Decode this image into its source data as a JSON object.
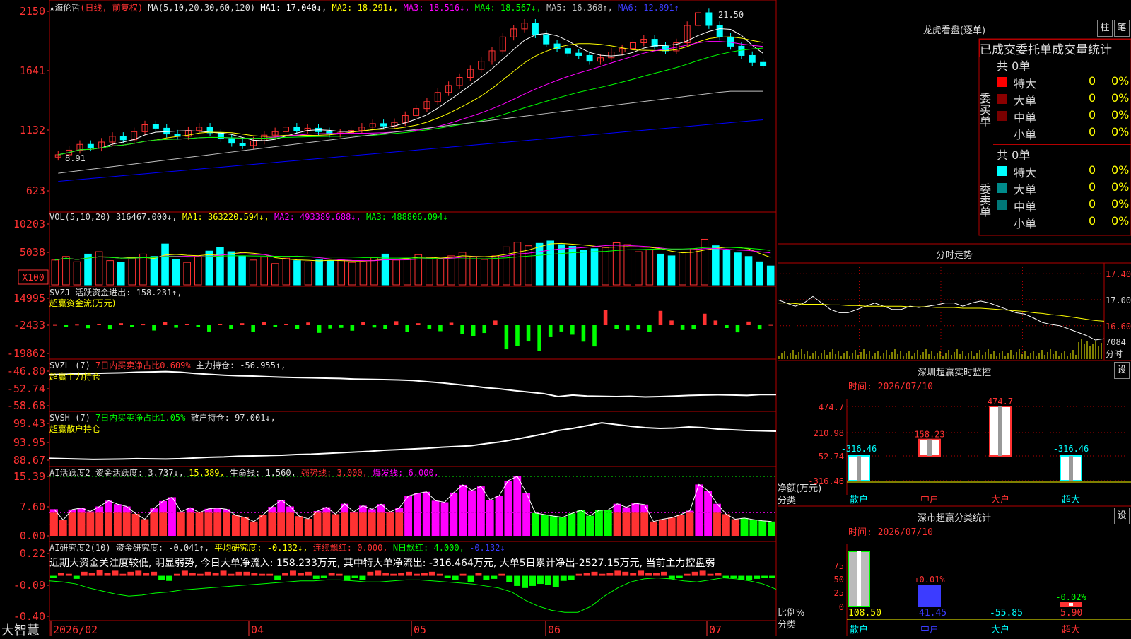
{
  "app": {
    "logo": "大智慧",
    "stock": "★海伦哲"
  },
  "colors": {
    "up": "#ff3232",
    "down": "#00ffff",
    "ma1": "#ffffff",
    "ma2": "#ffff00",
    "ma3": "#ff00ff",
    "ma4": "#00ff00",
    "ma5": "#c0c0c0",
    "ma6": "#0000ff",
    "grid": "#b40000"
  },
  "kline": {
    "period": "(日线, 前复权)",
    "ma_label": "MA(5,10,20,30,60,120)",
    "ma1": "MA1: 17.040↓,",
    "ma2": "MA2: 18.291↓,",
    "ma3": "MA3: 18.516↓,",
    "ma4": "MA4: 18.567↓,",
    "ma5": "MA5: 16.368↑,",
    "ma6": "MA6: 12.891↑",
    "high_mark": "21.50",
    "low_mark": "8.91",
    "y_ticks": [
      "2150",
      "1641",
      "1132",
      "623"
    ]
  },
  "vol": {
    "label": "VOL(5,10,20)",
    "value": "316467.000↓,",
    "ma1": "MA1: 363220.594↓,",
    "ma2": "MA2: 493389.688↓,",
    "ma3": "MA3: 488806.094↓",
    "y_ticks": [
      "10203",
      "5038"
    ],
    "unit": "X100"
  },
  "svzj": {
    "label": "SVZJ",
    "text": "活跃资金进出: 158.231↑,",
    "sub": "超赢资金流(万元)",
    "y_ticks": [
      "14995",
      "-2433",
      "-19862"
    ]
  },
  "svzl": {
    "label": "SVZL (7)",
    "text1": "7日内买卖净占比0.609%",
    "text2": "主力持仓: -56.955↑,",
    "sub": "超赢主力持仓",
    "y_ticks": [
      "-46.80",
      "-52.74",
      "-58.68"
    ]
  },
  "svsh": {
    "label": "SVSH (7)",
    "text1": "7日内买卖净占比1.05%",
    "text2": "散户持仓: 97.001↓,",
    "sub": "超赢散户持仓",
    "y_ticks": [
      "99.43",
      "93.95",
      "88.67"
    ]
  },
  "ai1": {
    "label": "AI活跃度2",
    "t1": "资金活跃度: 3.737↓,",
    "t2": "15.389,",
    "t3": "生命线: 1.560,",
    "t4": "强势线: 3.000,",
    "t5": "爆发线: 6.000,",
    "y_ticks": [
      "15.39",
      "7.60",
      "0.00"
    ]
  },
  "ai2": {
    "label": "AI研究度2(10)",
    "t1": "资金研究度: -0.041↑,",
    "t2": "平均研究度: -0.132↓,",
    "t3": "连续飘红: 0.000,",
    "t4": "N日飘红: 4.000,",
    "t5": "-0.132↓",
    "comment": "近期大资金关注度较低, 明显弱势, 今日大单净流入: 158.233万元, 其中特大单净流出: -316.464万元, 大单5日累计净出-2527.15万元, 当前主力控盘弱",
    "y_ticks": [
      "0.22",
      "-0.09",
      "-0.40"
    ]
  },
  "date_axis": [
    "2026/02",
    "04",
    "05",
    "06",
    "07"
  ],
  "right": {
    "lhb_title": "龙虎看盘(逐单)",
    "btn_zhu": "柱",
    "btn_bi": "笔",
    "header": "已成交委托单成交量统计",
    "buy_side": "委买单",
    "sell_side": "委卖单",
    "buy_total": "共 0单",
    "sell_total": "共 0单",
    "buy_rows": [
      {
        "label": "特大",
        "v": "0",
        "p": "0%",
        "color": "#ff0000"
      },
      {
        "label": "大单",
        "v": "0",
        "p": "0%",
        "color": "#8b0000"
      },
      {
        "label": "中单",
        "v": "0",
        "p": "0%",
        "color": "#7a0000"
      },
      {
        "label": "小单",
        "v": "0",
        "p": "0%",
        "color": "#000000"
      }
    ],
    "sell_rows": [
      {
        "label": "特大",
        "v": "0",
        "p": "0%",
        "color": "#00ffff"
      },
      {
        "label": "大单",
        "v": "0",
        "p": "0%",
        "color": "#008b8b"
      },
      {
        "label": "中单",
        "v": "0",
        "p": "0%",
        "color": "#007878"
      },
      {
        "label": "小单",
        "v": "0",
        "p": "0%",
        "color": "#000000"
      }
    ],
    "fenshi_title": "分时走势",
    "fenshi_ticks": [
      "17.40",
      "17.00",
      "16.60",
      "7084",
      "分时"
    ],
    "sz_title": "深圳超赢实时监控",
    "sz_btn": "设",
    "sz_date": "时间: 2026/07/10",
    "sz_ticks": [
      "474.7",
      "210.98",
      "-52.74",
      "-316.46"
    ],
    "sz_ylabel1": "净额(万元)",
    "sz_ylabel2": "分类",
    "sz_cats": [
      "散户",
      "中户",
      "大户",
      "超大"
    ],
    "sz_labels": [
      "-316.46",
      "158.23",
      "474.7",
      "-316.46"
    ],
    "fl_title": "深市超赢分类统计",
    "fl_btn": "设",
    "fl_date": "时间: 2026/07/10",
    "fl_ticks": [
      "75",
      "50",
      "25",
      "0"
    ],
    "fl_ylabel1": "比例%",
    "fl_ylabel2": "分类",
    "fl_bar_labels": [
      "",
      "+0.01%",
      "",
      "-0.02%"
    ],
    "fl_values": [
      "108.50",
      "41.45",
      "-55.85",
      "5.90"
    ],
    "fl_cats": [
      "散户",
      "中户",
      "大户",
      "超大"
    ]
  },
  "chart_data": [
    {
      "type": "candlestick",
      "title": "海伦哲 日线 前复权",
      "ylim": [
        623,
        2150
      ],
      "y_ticks": [
        2150,
        1641,
        1132,
        623
      ],
      "x_ticks": [
        "2026/02",
        "04",
        "05",
        "06",
        "07"
      ],
      "series_close": [
        9.2,
        9.6,
        10.1,
        9.8,
        10.3,
        10.8,
        10.5,
        11.2,
        11.8,
        11.5,
        11.0,
        10.8,
        11.3,
        11.6,
        11.1,
        10.6,
        10.2,
        10.0,
        10.4,
        10.9,
        11.2,
        11.6,
        11.3,
        11.5,
        11.2,
        11.0,
        11.1,
        11.3,
        11.6,
        11.9,
        11.7,
        12.0,
        12.6,
        13.2,
        13.8,
        14.6,
        15.2,
        15.9,
        16.6,
        17.3,
        18.2,
        19.4,
        20.1,
        20.6,
        19.6,
        18.8,
        18.4,
        18.0,
        17.8,
        17.3,
        17.6,
        18.1,
        18.4,
        18.9,
        19.2,
        18.6,
        18.2,
        18.9,
        20.4,
        21.5,
        20.4,
        19.4,
        18.6,
        17.8,
        17.2,
        16.9
      ],
      "ma_series": [
        "MA1",
        "MA2",
        "MA3",
        "MA4",
        "MA5",
        "MA6"
      ]
    },
    {
      "type": "bar",
      "title": "VOL(5,10,20)",
      "unit": "X100",
      "ylim": [
        0,
        12000
      ],
      "y_ticks": [
        10203,
        5038
      ],
      "values": [
        4200,
        4800,
        3900,
        5200,
        5600,
        4100,
        3800,
        4500,
        5200,
        4800,
        6900,
        4300,
        3800,
        4800,
        5700,
        6300,
        5600,
        4900,
        4200,
        4700,
        3600,
        4500,
        4100,
        3900,
        4200,
        4100,
        4200,
        3800,
        3900,
        4600,
        5200,
        4200,
        4300,
        5100,
        4600,
        4400,
        4900,
        5500,
        4700,
        4300,
        4900,
        6400,
        7200,
        6600,
        7000,
        7400,
        6800,
        6500,
        5900,
        6100,
        6300,
        7100,
        6800,
        5600,
        5900,
        5200,
        4900,
        5500,
        6100,
        7700,
        6600,
        5900,
        5400,
        4800,
        3900,
        3200
      ]
    },
    {
      "type": "bar",
      "title": "SVZJ 活跃资金进出",
      "unit": "万元",
      "ylim": [
        -19862,
        14995
      ],
      "y_ticks": [
        14995,
        -2433,
        -19862
      ],
      "values": [
        158,
        -900,
        300,
        -1800,
        500,
        -2600,
        1200,
        -900,
        400,
        -3200,
        2100,
        -1500,
        800,
        -900,
        -3800,
        600,
        -2200,
        1200,
        -4100,
        1900,
        -1200,
        700,
        -2500,
        1600,
        -4600,
        -2000,
        -1600,
        -3300,
        1800,
        -1400,
        -2200,
        2400,
        -3900,
        1200,
        -2100,
        -3600,
        1500,
        -5200,
        -6800,
        -4700,
        2800,
        -14500,
        -12600,
        -9800,
        -15400,
        -7200,
        -3800,
        -5700,
        -9900,
        -12800,
        9200,
        -2200,
        -3100,
        -2600,
        -4200,
        8600,
        2800,
        -2900,
        -2600,
        6900,
        2800,
        -1700,
        -4300,
        2200,
        -2600,
        158
      ]
    },
    {
      "type": "line",
      "title": "SVZL 主力持仓",
      "ylim": [
        -58.68,
        -46.8
      ],
      "y_ticks": [
        -46.8,
        -52.74,
        -58.68
      ],
      "values": [
        -48.2,
        -48.1,
        -47.9,
        -47.8,
        -47.7,
        -47.6,
        -47.4,
        -47.3,
        -47.2,
        -47.4,
        -47.8,
        -48.1,
        -48.4,
        -48.6,
        -48.7,
        -48.9,
        -49.1,
        -49.2,
        -49.3,
        -49.4,
        -49.5,
        -49.7,
        -49.8,
        -49.9,
        -50.0,
        -50.2,
        -50.6,
        -51.0,
        -51.5,
        -52.0,
        -52.6,
        -53.0,
        -53.6,
        -54.1,
        -54.6,
        -55.6,
        -55.1,
        -55.4,
        -55.5,
        -55.6,
        -55.5,
        -55.7,
        -55.6,
        -55.4,
        -55.2,
        -55.1,
        -55.0,
        -55.1,
        -55.2,
        -54.9,
        -54.95
      ]
    },
    {
      "type": "line",
      "title": "SVSH 散户持仓",
      "ylim": [
        88.67,
        99.43
      ],
      "y_ticks": [
        99.43,
        93.95,
        88.67
      ],
      "values": [
        89.2,
        89.1,
        89.0,
        88.9,
        88.95,
        89.0,
        89.1,
        89.05,
        89.0,
        89.1,
        89.3,
        89.5,
        89.6,
        89.8,
        89.9,
        90.0,
        90.1,
        90.3,
        90.4,
        90.6,
        90.8,
        91.0,
        91.2,
        91.5,
        91.7,
        91.9,
        92.1,
        92.4,
        92.6,
        92.8,
        93.4,
        93.9,
        94.6,
        95.4,
        96.2,
        97.2,
        97.8,
        98.6,
        99.4,
        98.9,
        98.4,
        98.0,
        97.8,
        97.9,
        98.2,
        98.0,
        97.6,
        97.4,
        97.2,
        97.1,
        97.0
      ]
    },
    {
      "type": "bar",
      "title": "AI活跃度2 资金活跃度",
      "ylim": [
        0,
        15.39
      ],
      "y_ticks": [
        15.39,
        7.6,
        0.0
      ],
      "values": [
        6.9,
        4.1,
        6.8,
        7.2,
        6.3,
        7.6,
        9.1,
        8.2,
        7.6,
        5.7,
        4.3,
        7.1,
        9.0,
        10.0,
        6.2,
        7.3,
        6.0,
        7.0,
        7.2,
        6.9,
        5.3,
        4.8,
        3.7,
        5.4,
        7.5,
        9.3,
        7.6,
        5.1,
        4.4,
        6.4,
        7.4,
        5.6,
        8.3,
        6.2,
        7.8,
        6.9,
        8.2,
        6.2,
        7.2,
        10.3,
        11.0,
        11.4,
        9.1,
        8.7,
        11.2,
        13.2,
        11.8,
        12.8,
        9.3,
        10.4,
        14.3,
        15.4,
        11.1,
        5.9,
        5.5,
        5.1,
        4.8,
        5.8,
        6.6,
        5.2,
        6.6,
        6.7,
        8.3,
        7.4,
        8.4,
        8.1,
        3.7,
        4.3,
        4.7,
        5.5,
        6.5,
        13.3,
        11.7,
        8.3,
        5.6,
        4.3,
        4.6,
        4.2,
        3.9,
        3.7
      ],
      "reference_lines": {
        "生命线": 1.56,
        "强势线": 3.0,
        "爆发线": 6.0,
        "上限": 15.389
      }
    },
    {
      "type": "bar",
      "title": "AI研究度2(10) 资金研究度",
      "ylim": [
        -0.4,
        0.22
      ],
      "y_ticks": [
        0.22,
        -0.09,
        -0.4
      ],
      "values": [
        -0.02,
        0.03,
        0.02,
        -0.03,
        0.04,
        0.03,
        0.06,
        0.03,
        0.05,
        0.02,
        0.04,
        0.05,
        0.03,
        0.04,
        -0.04,
        -0.05,
        0.02,
        0.05,
        0.03,
        0.02,
        0.04,
        0.03,
        0.05,
        0.02,
        0.04,
        0.04,
        0.03,
        0.02,
        0.02,
        -0.04,
        0.03,
        0.05,
        0.03,
        0.04,
        -0.03,
        -0.02,
        0.03,
        0.02,
        -0.05,
        -0.02,
        -0.04,
        0.04,
        0.05,
        0.03,
        0.02,
        0.03,
        0.04,
        0.02,
        0.03,
        0.04,
        0.02,
        -0.02,
        -0.04,
        0.02,
        -0.06,
        0.03,
        -0.04,
        -0.03,
        0.02,
        -0.06,
        -0.1,
        -0.12,
        -0.1,
        -0.08,
        -0.09,
        -0.11,
        -0.05,
        -0.04,
        0.02,
        0.03,
        0.04,
        0.02,
        0.03,
        0.05,
        0.04,
        0.03,
        0.05,
        0.03,
        0.03,
        0.04,
        -0.03,
        -0.02,
        0.02,
        0.04,
        0.05,
        0.02,
        0.03,
        -0.02,
        -0.02,
        -0.04,
        -0.04,
        -0.03,
        -0.02,
        -0.02
      ],
      "avg_line": [
        -0.05,
        -0.06,
        -0.08,
        -0.12,
        -0.15,
        -0.18,
        -0.2,
        -0.19,
        -0.17,
        -0.16,
        -0.14,
        -0.13,
        -0.12,
        -0.11,
        -0.1,
        -0.09,
        -0.08,
        -0.07,
        -0.06,
        -0.05,
        -0.05,
        -0.04,
        -0.04,
        -0.05,
        -0.06,
        -0.06,
        -0.05,
        -0.04,
        -0.04,
        -0.05,
        -0.06,
        -0.07,
        -0.08,
        -0.1,
        -0.12,
        -0.16,
        -0.24,
        -0.3,
        -0.34,
        -0.36,
        -0.36,
        -0.3,
        -0.2,
        -0.12,
        -0.06,
        -0.03,
        -0.02,
        -0.03,
        -0.05,
        -0.06,
        -0.04,
        -0.02,
        -0.03,
        -0.05,
        -0.08,
        -0.132
      ]
    },
    {
      "type": "line",
      "title": "分时走势",
      "ylim": [
        16.5,
        17.5
      ],
      "y_ticks": [
        17.4,
        17.0,
        16.6
      ],
      "values": [
        17.0,
        16.95,
        16.9,
        16.95,
        17.05,
        16.95,
        16.85,
        16.8,
        16.8,
        16.85,
        16.9,
        16.95,
        16.9,
        16.85,
        16.85,
        16.9,
        16.88,
        16.9,
        16.92,
        16.95,
        16.95,
        16.9,
        16.95,
        16.98,
        16.95,
        16.9,
        16.85,
        16.8,
        16.78,
        16.72,
        16.65,
        16.62,
        16.6,
        16.55,
        16.5,
        16.45,
        16.38,
        16.4
      ],
      "avg_line": [
        16.95,
        16.95,
        16.94,
        16.93,
        16.93,
        16.93,
        16.92,
        16.92,
        16.91,
        16.91,
        16.9,
        16.9,
        16.9,
        16.9,
        16.9,
        16.89,
        16.89,
        16.89,
        16.88,
        16.88,
        16.88,
        16.87,
        16.87,
        16.87,
        16.86,
        16.85,
        16.84,
        16.83,
        16.82,
        16.8,
        16.79,
        16.77,
        16.76,
        16.74,
        16.72,
        16.7,
        16.68,
        16.67
      ]
    },
    {
      "type": "bar",
      "title": "深圳超赢实时监控",
      "ylabel": "净额(万元)",
      "categories": [
        "散户",
        "中户",
        "大户",
        "超大"
      ],
      "values": [
        -316.46,
        158.23,
        474.7,
        -316.46
      ],
      "ylim": [
        -316.46,
        474.7
      ],
      "y_ticks": [
        474.7,
        210.98,
        -52.74,
        -316.46
      ]
    },
    {
      "type": "bar",
      "title": "深市超赢分类统计",
      "ylabel": "比例%",
      "categories": [
        "散户",
        "中户",
        "大户",
        "超大"
      ],
      "values": [
        108.5,
        41.45,
        -55.85,
        5.9
      ],
      "ylim": [
        0,
        100
      ],
      "y_ticks": [
        75,
        50,
        25,
        0
      ]
    }
  ]
}
